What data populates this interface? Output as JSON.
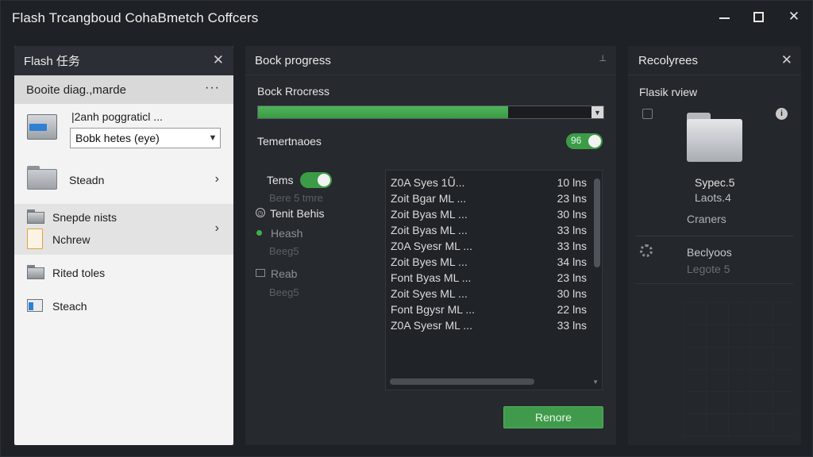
{
  "window": {
    "title": "Flash Trcangboud CohaBmetch Coffcers",
    "controls": {
      "minimize": "—",
      "maximize": "☐",
      "close": "✕"
    }
  },
  "left_panel": {
    "header": "Flash 任务",
    "subheader": "Booite diag.,marde",
    "more": "···",
    "items": [
      {
        "title": "|2anh poggraticl ..."
      },
      {
        "label": "Steadn"
      },
      {
        "label": "Snepde nists"
      },
      {
        "label": "Nchrew"
      },
      {
        "label": "Rited toles"
      },
      {
        "label": "Steach"
      }
    ],
    "select": {
      "value": "Bobk hetes (eye)"
    }
  },
  "middle_panel": {
    "header": "Bock progress",
    "progress_label": "Bock Rrocress",
    "progress_value": 0.75,
    "setting_label": "Temertnaoes",
    "setting_toggle_value": "96",
    "options": [
      {
        "label": "Tems",
        "toggle": true
      },
      {
        "label": "Bere 5 tmre",
        "faint": true
      },
      {
        "label": "Tenit Behis"
      },
      {
        "label": "Heash"
      },
      {
        "label": "Beeg5",
        "faint": true
      },
      {
        "label": "Reab"
      },
      {
        "label": "Beeg5",
        "faint": true
      }
    ],
    "files": [
      {
        "name": "Z0A Syes 1Ũ...",
        "size": "10 lns"
      },
      {
        "name": "Zoit Bgar ML ...",
        "size": "23 lns"
      },
      {
        "name": "Zoit Byas ML ...",
        "size": "30 lns"
      },
      {
        "name": "Zoit Byas ML ...",
        "size": "33 lns"
      },
      {
        "name": "Z0A Syesr ML ...",
        "size": "33 lns"
      },
      {
        "name": "Zoit Byes ML ...",
        "size": "34 lns"
      },
      {
        "name": "Font Byas ML ...",
        "size": "23 lns"
      },
      {
        "name": "Zoit Syes ML ...",
        "size": "30 lns"
      },
      {
        "name": "Font Bgysr ML ...",
        "size": "22 lns"
      },
      {
        "name": "Z0A Syesr ML ...",
        "size": "33 lns"
      }
    ],
    "remove_button": "Renore"
  },
  "right_panel": {
    "header": "Recolyrees",
    "preview_title": "Flasik rview",
    "file_line1": "Sypec.5",
    "file_line2": "Laots.4",
    "file_line3": "Craners",
    "section_label": "Beclyoos",
    "section_sub": "Legote 5"
  },
  "colors": {
    "accent_green": "#3f9b4b",
    "background": "#1e2125",
    "panel_light": "#f3f3f3"
  }
}
